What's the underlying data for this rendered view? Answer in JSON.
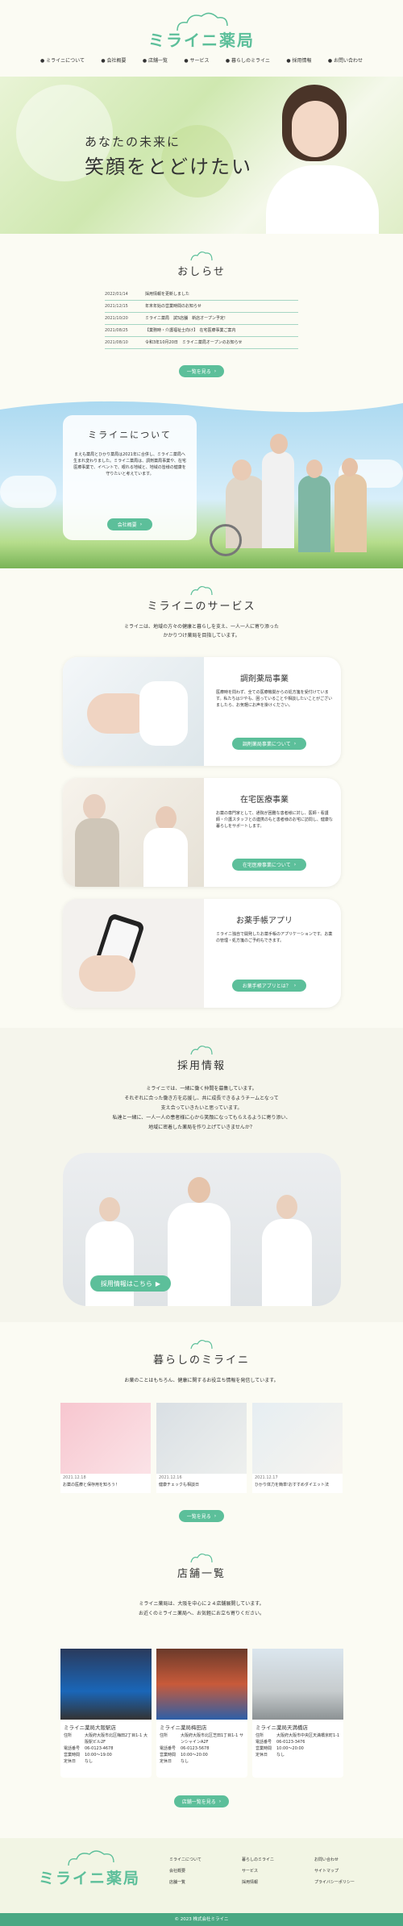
{
  "header": {
    "logo_text": "ミライニ薬局",
    "nav": [
      "ミライニについて",
      "会社概要",
      "店舗一覧",
      "サービス",
      "暮らしのミライニ",
      "採用情報",
      "お問い合わせ"
    ]
  },
  "hero": {
    "line1": "あなたの未来に",
    "line2": "笑顔をとどけたい"
  },
  "news": {
    "title": "おしらせ",
    "items": [
      {
        "date": "2022/01/14",
        "text": "採用情報を更新しました"
      },
      {
        "date": "2021/12/15",
        "text": "年末年始の営業時間のお知らせ"
      },
      {
        "date": "2021/10/20",
        "text": "ミライニ薬局　試5店舗　新店オープン予定!"
      },
      {
        "date": "2021/08/25",
        "text": "【業務時・介護福祉士向け】　在宅医療事業ご案内"
      },
      {
        "date": "2021/08/10",
        "text": "令和3年10月20日　ミライニ薬局オープンのお知らせ"
      }
    ],
    "button": "一覧を見る"
  },
  "about": {
    "title": "ミライニについて",
    "body": "まえも薬局とひかり薬局は2021年に合併し、ミライニ薬局へ生まれ変わりました。ミライニ薬局は、調剤薬局事業や、在宅医療事業で、イベントで、眼れる地域と、地域の皆様の健康を守りたいと考えています。",
    "button": "会社概要"
  },
  "services": {
    "title": "ミライニのサービス",
    "lead1": "ミライニは、地域の方々の健康と暮らしを支え、一人一人に寄り添った",
    "lead2": "かかりつけ薬局を目指しています。",
    "cards": [
      {
        "title": "調剤薬局事業",
        "body": "医療時を問わず、全ての医療機関からの処方箋を受付けています。私たちは少やも、困っていることや相談したいことがございましたら、お気軽にお声を掛けください。",
        "button": "調剤薬局事業について"
      },
      {
        "title": "在宅医療事業",
        "body": "お薬の専門家として、通院が困難な患者様に対し、医師・看護師・介護スタッフとの連携のもと患者様のお宅に訪問し、健康な暮らしをサポートします。",
        "button": "在宅医療事業について"
      },
      {
        "title": "お薬手帳アプリ",
        "body": "ミライニ独自で開発したお薬手帳のアプリケーションです。お薬の管理・処方箋のご予約もできます。",
        "button": "お薬手帳アプリとは？"
      }
    ]
  },
  "recruit": {
    "title": "採用情報",
    "p1": "ミライニでは、一緒に働く仲間を募集しています。",
    "p2": "それぞれに合った働き方を応援し、共に成長できるようチームとなって",
    "p3": "支え合っていきたいと思っています。",
    "p4": "私達と一緒に、一人一人の患者様に心から笑顔になってもらえるように寄り添い、",
    "p5": "地域に密着した薬局を作り上げていきませんか？",
    "button": "採用情報はこちら"
  },
  "life": {
    "title": "暮らしのミライニ",
    "lead": "お薬のことはもちろん、健康に関するお役立ち情報を発信しています。",
    "posts": [
      {
        "date": "2021.12.18",
        "text": "お薬の医療と保存用を知ろう！"
      },
      {
        "date": "2021.12.16",
        "text": "健康チェックも相談日"
      },
      {
        "date": "2021.12.17",
        "text": "ひかり体力を簡単!おすすめダイエット法"
      }
    ],
    "button": "一覧を見る"
  },
  "stores": {
    "title": "店舗一覧",
    "lead1": "ミライニ薬局は、大阪を中心に２４店舗展開しています。",
    "lead2": "お近くのミライニ薬局へ、お気軽にお立ち寄りください。",
    "items": [
      {
        "name": "ミライニ薬局大阪駅店",
        "rows": [
          [
            "住所",
            "大阪府大阪市北区梅田2丁目1-1 大阪駅ビル2F"
          ],
          [
            "電話番号",
            "06-0123-4678"
          ],
          [
            "営業時間",
            "10:00～19:00"
          ],
          [
            "定休日",
            "なし"
          ]
        ]
      },
      {
        "name": "ミライニ薬局梅田店",
        "rows": [
          [
            "住所",
            "大阪府大阪市北区芝田1丁目1-1 サンシャインA2F"
          ],
          [
            "電話番号",
            "06-0123-5678"
          ],
          [
            "営業時間",
            "10:00～20:00"
          ],
          [
            "定休日",
            "なし"
          ]
        ]
      },
      {
        "name": "ミライニ薬局天満橋店",
        "rows": [
          [
            "住所",
            "大阪府大阪市中央区天満橋京町1-1"
          ],
          [
            "電話番号",
            "06-0123-3476"
          ],
          [
            "営業時間",
            "10:00～20:00"
          ],
          [
            "定休日",
            "なし"
          ]
        ]
      }
    ],
    "button": "店舗一覧を見る"
  },
  "footer": {
    "logo_text": "ミライニ薬局",
    "col1": [
      "ミライニについて",
      "会社概要",
      "店舗一覧"
    ],
    "col2": [
      "暮らしのミライニ",
      "サービス",
      "採用情報"
    ],
    "col3": [
      "お問い合わせ",
      "サイトマップ",
      "プライバシーポリシー"
    ],
    "copyright": "© 2023 株式会社ミライニ"
  },
  "colors": {
    "accent": "#5cbf9a",
    "footer": "#4aa883",
    "bg": "#fbfbf3"
  }
}
